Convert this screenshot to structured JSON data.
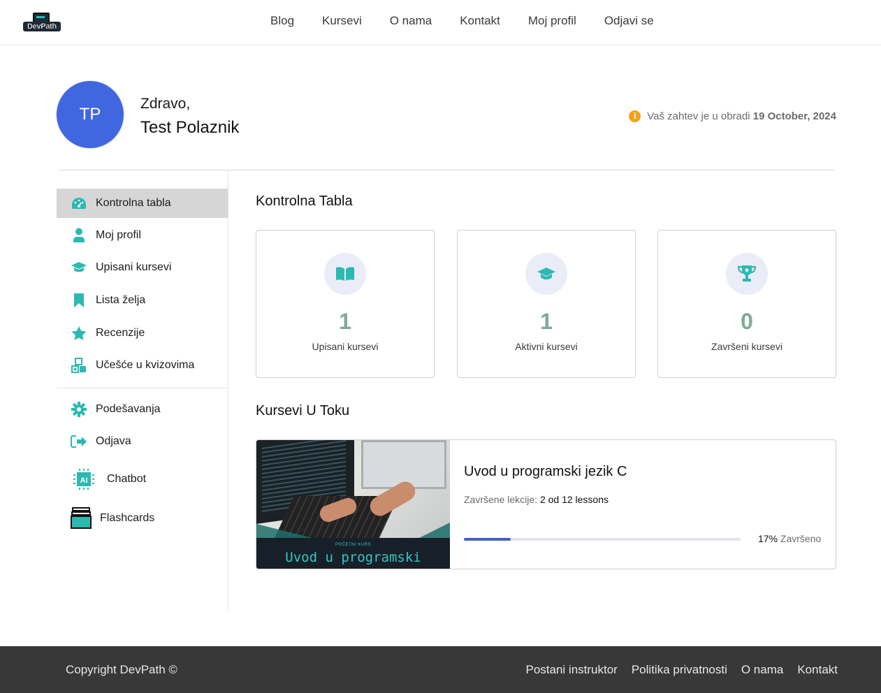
{
  "brand": {
    "logo_text": "DevPath"
  },
  "nav": {
    "items": [
      "Blog",
      "Kursevi",
      "O nama",
      "Kontakt",
      "Moj profil",
      "Odjavi se"
    ]
  },
  "profile": {
    "initials": "TP",
    "greeting": "Zdravo,",
    "name": "Test Polaznik",
    "notice_text": "Vaš zahtev je u obradi",
    "notice_date": "19 October, 2024",
    "notice_icon": "info-icon"
  },
  "sidebar": {
    "items": [
      {
        "label": "Kontrolna tabla",
        "icon": "dashboard-icon",
        "active": true
      },
      {
        "label": "Moj profil",
        "icon": "user-icon"
      },
      {
        "label": "Upisani kursevi",
        "icon": "graduation-cap-icon"
      },
      {
        "label": "Lista želja",
        "icon": "bookmark-icon"
      },
      {
        "label": "Recenzije",
        "icon": "star-icon"
      },
      {
        "label": "Učešće u kvizovima",
        "icon": "quiz-shapes-icon"
      },
      {
        "label": "Podešavanja",
        "icon": "gear-icon"
      },
      {
        "label": "Odjava",
        "icon": "logout-icon"
      },
      {
        "label": "Chatbot",
        "icon": "ai-chip-icon"
      },
      {
        "label": "Flashcards",
        "icon": "flashcards-icon"
      }
    ]
  },
  "dashboard": {
    "title": "Kontrolna Tabla",
    "stats": [
      {
        "value": "1",
        "label": "Upisani kursevi",
        "icon": "book-icon"
      },
      {
        "value": "1",
        "label": "Aktivni kursevi",
        "icon": "graduation-cap-icon"
      },
      {
        "value": "0",
        "label": "Završeni kursevi",
        "icon": "trophy-icon"
      }
    ]
  },
  "in_progress": {
    "title": "Kursevi U Toku",
    "course": {
      "thumb_small": "POČETNI KURS",
      "thumb_big": "Uvod u programski",
      "title": "Uvod u programski jezik C",
      "lessons_label": "Završene lekcije:",
      "lessons_value": "2 od 12 lessons",
      "progress_fraction": 0.17,
      "progress_percent": "17%",
      "progress_label": "Završeno"
    }
  },
  "footer": {
    "copyright": "Copyright DevPath ©",
    "links": [
      "Postani instruktor",
      "Politika privatnosti",
      "O nama",
      "Kontakt"
    ]
  },
  "colors": {
    "accent_teal": "#2bb9b2",
    "avatar_blue": "#4167e0",
    "progress_blue": "#4360c8",
    "info_orange": "#f0a21b",
    "footer_bg": "#383838"
  }
}
